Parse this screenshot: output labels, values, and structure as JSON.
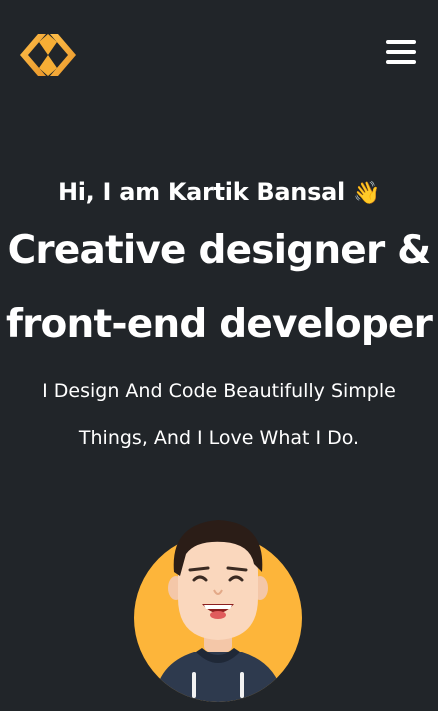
{
  "header": {
    "logo_icon": "code-brackets-logo",
    "menu_icon": "hamburger-menu-icon",
    "accent_color": "#F4A72B"
  },
  "hero": {
    "greeting": "Hi, I am Kartik Bansal",
    "greeting_emoji": "👋",
    "headline_line1": "Creative designer &",
    "headline_line2": "front-end developer",
    "tagline_line1": "I Design And Code Beautifully Simple",
    "tagline_line2": "Things, And I Love What I Do.",
    "avatar_icon": "memoji-avatar"
  },
  "colors": {
    "background": "#212529",
    "text": "#FFFFFF",
    "avatar_circle": "#FDB53A",
    "hoodie": "#2E3A4E"
  }
}
